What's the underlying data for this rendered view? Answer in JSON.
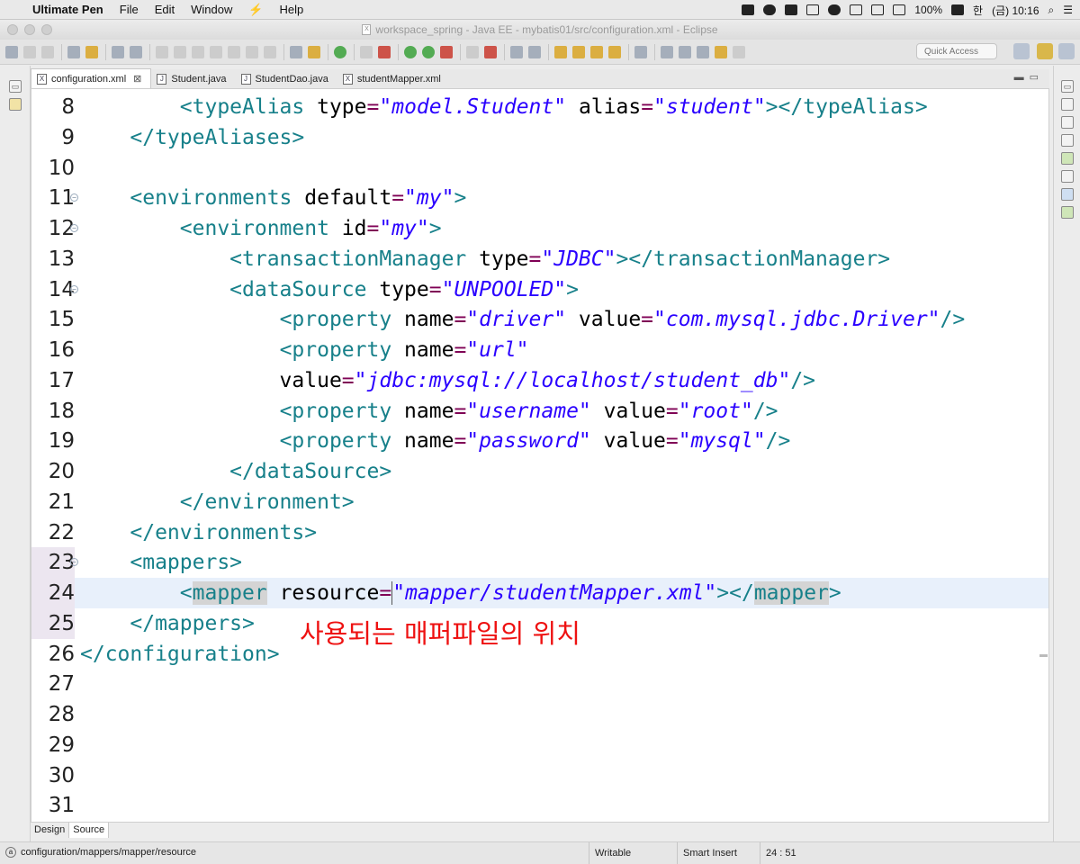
{
  "menubar": {
    "app": "Ultimate Pen",
    "menus": [
      "File",
      "Edit",
      "Window",
      "Help"
    ],
    "battery": "100%",
    "ime": "한",
    "clock": "(금) 10:16"
  },
  "window": {
    "title": "workspace_spring - Java EE - mybatis01/src/configuration.xml - Eclipse"
  },
  "toolbar": {
    "quick_access": "Quick Access"
  },
  "tabs": [
    {
      "label": "configuration.xml",
      "icon": "X",
      "active": true
    },
    {
      "label": "Student.java",
      "icon": "J"
    },
    {
      "label": "StudentDao.java",
      "icon": "J"
    },
    {
      "label": "studentMapper.xml",
      "icon": "X"
    }
  ],
  "code_lines": [
    {
      "n": "8",
      "text": "        <typeAlias type=\"model.Student\" alias=\"student\"></typeAlias>"
    },
    {
      "n": "9",
      "text": "    </typeAliases>"
    },
    {
      "n": "10",
      "text": ""
    },
    {
      "n": "11",
      "text": "    <environments default=\"my\">",
      "fold": true
    },
    {
      "n": "12",
      "text": "        <environment id=\"my\">",
      "fold": true
    },
    {
      "n": "13",
      "text": "            <transactionManager type=\"JDBC\"></transactionManager>"
    },
    {
      "n": "14",
      "text": "            <dataSource type=\"UNPOOLED\">",
      "fold": true
    },
    {
      "n": "15",
      "text": "                <property name=\"driver\" value=\"com.mysql.jdbc.Driver\"/>"
    },
    {
      "n": "16",
      "text": "                <property name=\"url\""
    },
    {
      "n": "17",
      "text": "                value=\"jdbc:mysql://localhost/student_db\"/>"
    },
    {
      "n": "18",
      "text": "                <property name=\"username\" value=\"root\"/>"
    },
    {
      "n": "19",
      "text": "                <property name=\"password\" value=\"mysql\"/>"
    },
    {
      "n": "20",
      "text": "            </dataSource>"
    },
    {
      "n": "21",
      "text": "        </environment>"
    },
    {
      "n": "22",
      "text": "    </environments>"
    },
    {
      "n": "23",
      "text": "    <mappers>",
      "fold": true
    },
    {
      "n": "24",
      "text": "        <mapper resource=\"mapper/studentMapper.xml\"></mapper>",
      "current": true
    },
    {
      "n": "25",
      "text": "    </mappers>"
    },
    {
      "n": "26",
      "text": "</configuration>"
    },
    {
      "n": "27",
      "text": ""
    },
    {
      "n": "28",
      "text": ""
    },
    {
      "n": "29",
      "text": ""
    },
    {
      "n": "30",
      "text": ""
    },
    {
      "n": "31",
      "text": ""
    }
  ],
  "annotation": "사용되는 매퍼파일의 위치",
  "editor_tabs": [
    {
      "label": "Design"
    },
    {
      "label": "Source",
      "active": true
    }
  ],
  "status": {
    "path": "configuration/mappers/mapper/resource",
    "mode": "Writable",
    "insert": "Smart Insert",
    "position": "24 : 51"
  }
}
